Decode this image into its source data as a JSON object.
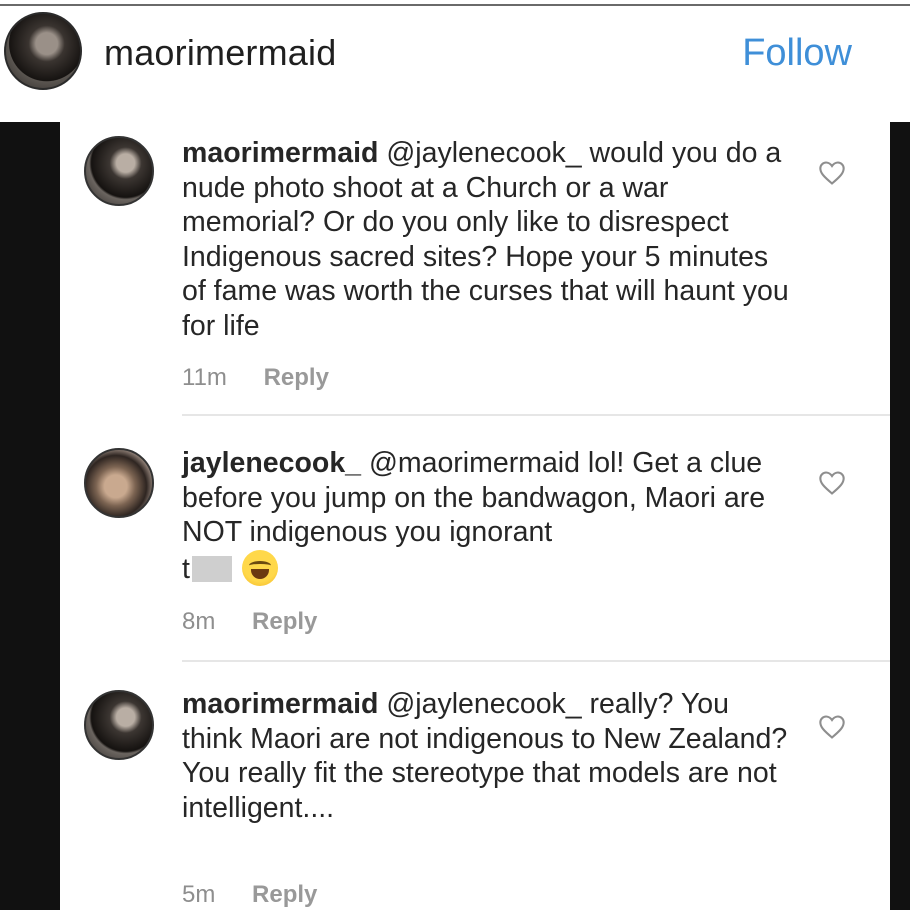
{
  "header": {
    "username": "maorimermaid",
    "follow_label": "Follow"
  },
  "comments": [
    {
      "user": "maorimermaid",
      "text": "@jaylenecook_ would you do a nude photo shoot at a Church or a war memorial? Or do you only like to disrespect Indigenous sacred sites? Hope your 5 minutes of fame was worth the curses that will haunt you for life",
      "time": "11m",
      "reply_label": "Reply"
    },
    {
      "user": "jaylenecook_",
      "text": "@maorimermaid lol! Get a clue before you jump on the bandwagon, Maori are NOT indigenous you ignorant",
      "text_tail": "t",
      "time": "8m",
      "reply_label": "Reply"
    },
    {
      "user": "maorimermaid",
      "text": "@jaylenecook_ really? You think Maori are not indigenous to New Zealand? You really fit the stereotype that models are not intelligent....",
      "time": "5m",
      "reply_label": "Reply"
    }
  ],
  "icons": {
    "heart": "heart-outline-icon",
    "emoji": "face-with-tears-of-joy-icon"
  }
}
